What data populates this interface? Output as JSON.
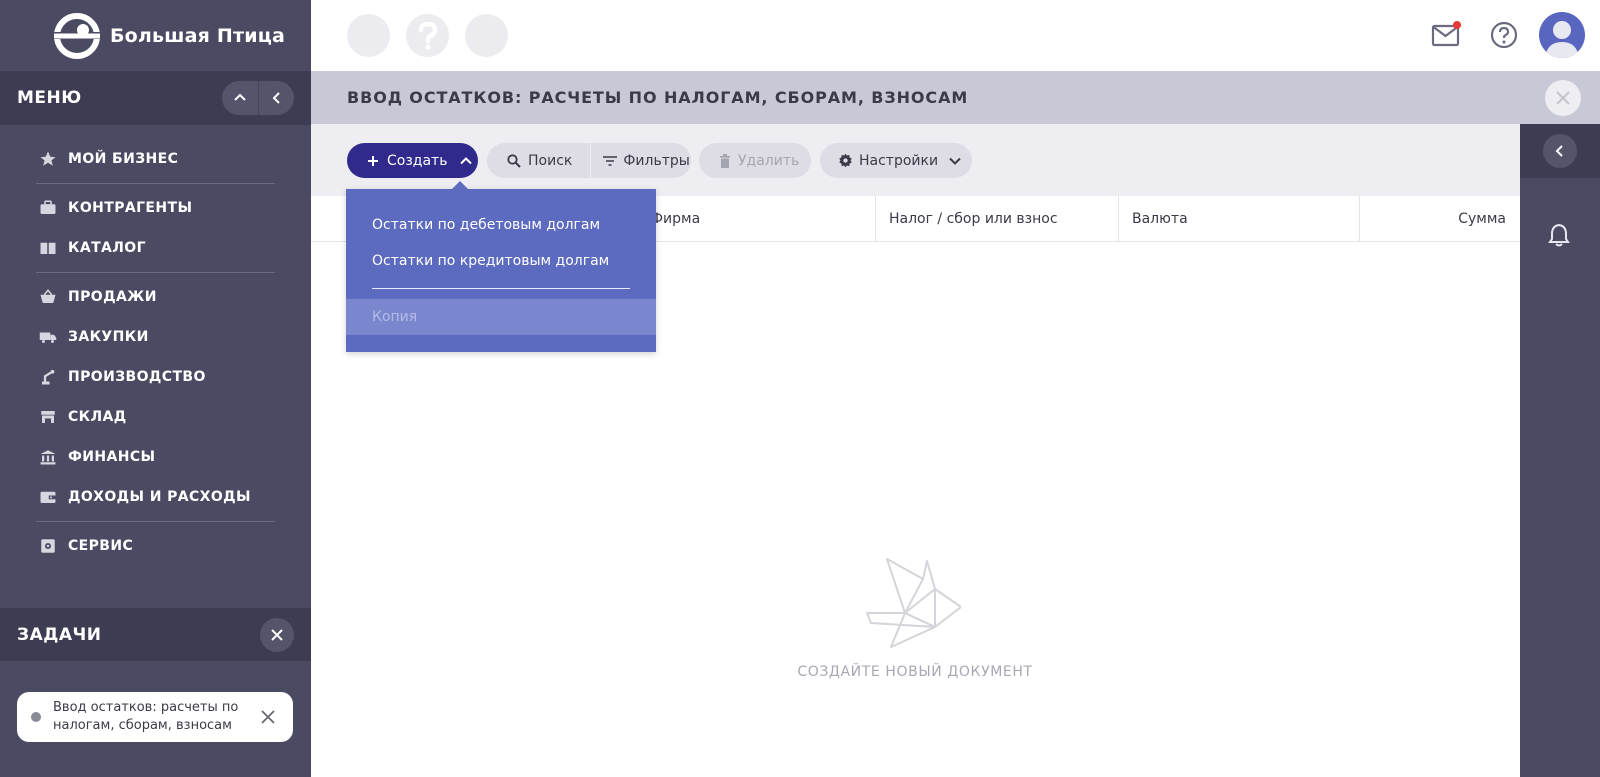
{
  "app": {
    "name": "Большая Птица"
  },
  "sidebar": {
    "menu_title": "МЕНЮ",
    "items": [
      {
        "label": "МОЙ БИЗНЕС",
        "icon": "star-icon"
      },
      {
        "label": "КОНТРАГЕНТЫ",
        "icon": "briefcase-icon"
      },
      {
        "label": "КАТАЛОГ",
        "icon": "book-icon"
      },
      {
        "label": "ПРОДАЖИ",
        "icon": "basket-icon"
      },
      {
        "label": "ЗАКУПКИ",
        "icon": "truck-icon"
      },
      {
        "label": "ПРОИЗВОДСТВО",
        "icon": "robot-arm-icon"
      },
      {
        "label": "СКЛАД",
        "icon": "warehouse-icon"
      },
      {
        "label": "ФИНАНСЫ",
        "icon": "bank-icon"
      },
      {
        "label": "ДОХОДЫ И РАСХОДЫ",
        "icon": "wallet-icon"
      },
      {
        "label": "СЕРВИС",
        "icon": "service-icon"
      }
    ],
    "tasks_title": "ЗАДАЧИ",
    "task": {
      "text": "Ввод остатков: расчеты по налогам, сборам, взносам"
    }
  },
  "header": {
    "notification_color": "#e53935"
  },
  "page": {
    "title": "ВВОД ОСТАТКОВ: РАСЧЕТЫ ПО НАЛОГАМ, СБОРАМ, ВЗНОСАМ"
  },
  "toolbar": {
    "create_label": "Создать",
    "search_label": "Поиск",
    "filters_label": "Фильтры",
    "delete_label": "Удалить",
    "settings_label": "Настройки"
  },
  "dropdown": {
    "items": [
      "Остатки по дебетовым долгам",
      "Остатки по кредитовым долгам"
    ],
    "disabled_item": "Копия"
  },
  "table": {
    "columns": [
      "Фирма",
      "Налог / сбор или взнос",
      "Валюта",
      "Сумма"
    ]
  },
  "empty_state": {
    "text": "СОЗДАЙТЕ НОВЫЙ ДОКУМЕНТ"
  },
  "colors": {
    "accent": "#2f2a8c",
    "sidebar": "#4b4a63",
    "dropdown": "#5c6bc0"
  }
}
